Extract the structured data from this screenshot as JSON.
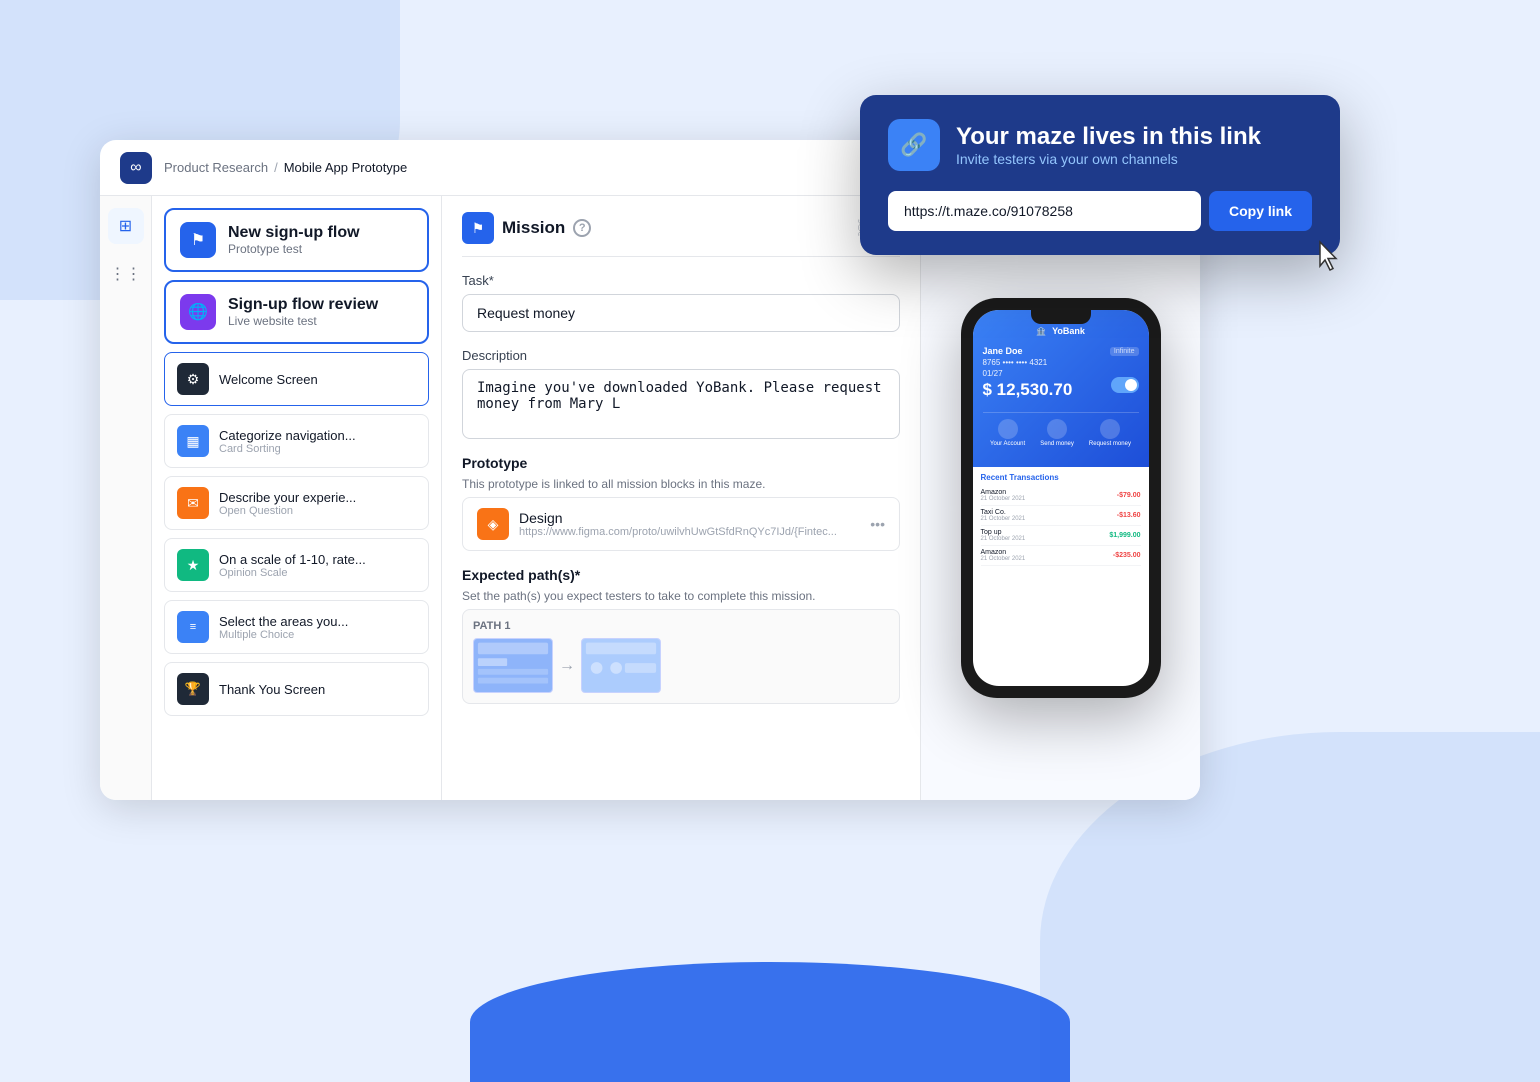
{
  "app": {
    "title": "Mobile App Prototype",
    "breadcrumb_parent": "Product Research",
    "breadcrumb_sep": "/",
    "breadcrumb_current": "Mobile App Prototype"
  },
  "sidebar": {
    "logo": "∞",
    "icons": [
      {
        "name": "grid-icon",
        "symbol": "⊞",
        "active": true
      },
      {
        "name": "apps-icon",
        "symbol": "⋮⋮",
        "active": false
      }
    ]
  },
  "projects": [
    {
      "id": "new-signup",
      "icon": "⚑",
      "icon_style": "blue",
      "title": "New sign-up flow",
      "subtitle": "Prototype test"
    },
    {
      "id": "signup-review",
      "icon": "🌐",
      "icon_style": "purple",
      "title": "Sign-up flow review",
      "subtitle": "Live website test"
    }
  ],
  "screens": [
    {
      "id": "welcome",
      "icon": "⚙",
      "icon_style": "dark",
      "title": "Welcome Screen",
      "active": true
    },
    {
      "id": "categorize",
      "icon": "▦",
      "icon_style": "blue",
      "title": "Categorize navigation...",
      "subtitle": "Card Sorting"
    },
    {
      "id": "describe",
      "icon": "✉",
      "icon_style": "orange",
      "title": "Describe your experie...",
      "subtitle": "Open Question"
    },
    {
      "id": "rate",
      "icon": "★",
      "icon_style": "green",
      "title": "On a scale of 1-10, rate...",
      "subtitle": "Opinion Scale"
    },
    {
      "id": "select",
      "icon": "≡",
      "icon_style": "blue",
      "title": "Select the areas you...",
      "subtitle": "Multiple Choice"
    },
    {
      "id": "thankyou",
      "icon": "🏆",
      "icon_style": "dark",
      "title": "Thank You Screen"
    }
  ],
  "mission": {
    "title": "Mission",
    "help_label": "?",
    "task_label": "Task*",
    "task_value": "Request money",
    "description_label": "Description",
    "description_value": "Imagine you've downloaded YoBank. Please request money from Mary L",
    "prototype_label": "Prototype",
    "prototype_desc": "This prototype is linked to all mission blocks in this maze.",
    "prototype_name": "Design",
    "prototype_url": "https://www.figma.com/proto/uwilvhUwGtSfdRnQYc7IJd/{Fintec...",
    "expected_paths_label": "Expected path(s)*",
    "expected_paths_desc": "Set the path(s) you expect testers to take to complete this mission.",
    "path_label": "PATH 1"
  },
  "yobank": {
    "app_name": "YoBank",
    "user_name": "Jane Doe",
    "card_number": "8765 •••• •••• 4321",
    "card_expiry": "01/27",
    "balance": "$ 12,530.70",
    "actions": [
      "Your Account",
      "Send money",
      "Request money"
    ],
    "transactions_title": "Recent Transactions",
    "transactions": [
      {
        "name": "Amazon",
        "date": "21 October 2021",
        "amount": "-$79.00",
        "type": "negative"
      },
      {
        "name": "Taxi Co.",
        "date": "21 October 2021",
        "amount": "-$13.60",
        "type": "negative"
      },
      {
        "name": "Top up",
        "date": "21 October 2021",
        "amount": "$1,999.00",
        "type": "positive"
      },
      {
        "name": "Amazon",
        "date": "21 October 2021",
        "amount": "-$235.00",
        "type": "negative"
      }
    ]
  },
  "popup": {
    "icon": "🔗",
    "title": "Your maze lives in this link",
    "subtitle": "Invite testers via your own channels",
    "link_url": "https://t.maze.co/91078258",
    "copy_button_label": "Copy link"
  }
}
